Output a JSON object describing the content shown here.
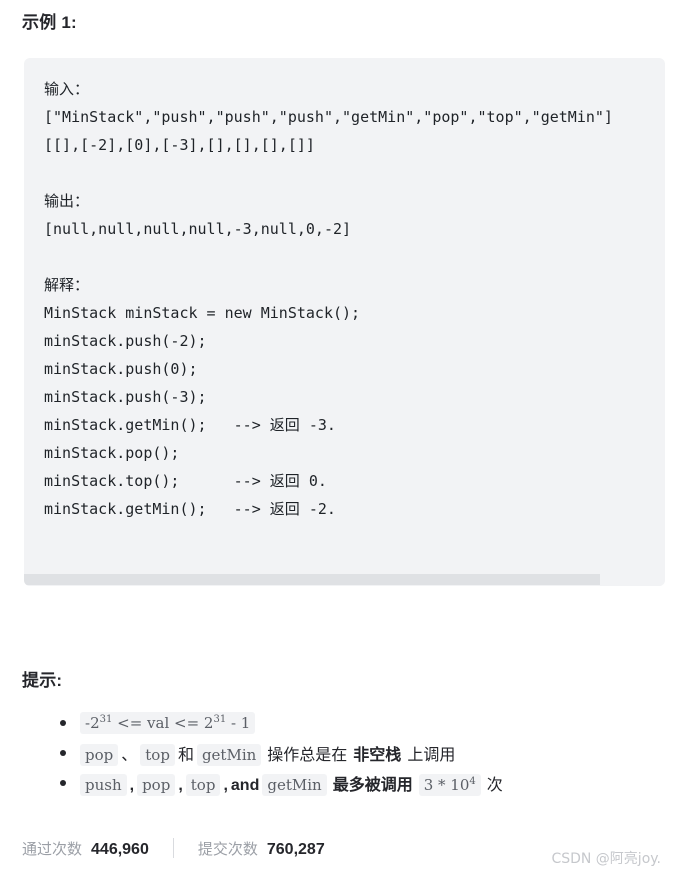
{
  "example": {
    "heading": "示例 1:",
    "code_lines": [
      "输入：",
      "[\"MinStack\",\"push\",\"push\",\"push\",\"getMin\",\"pop\",\"top\",\"getMin\"]",
      "[[],[-2],[0],[-3],[],[],[],[]]",
      "",
      "输出：",
      "[null,null,null,null,-3,null,0,-2]",
      "",
      "解释：",
      "MinStack minStack = new MinStack();",
      "minStack.push(-2);",
      "minStack.push(0);",
      "minStack.push(-3);",
      "minStack.getMin();   --> 返回 -3.",
      "minStack.pop();",
      "minStack.top();      --> 返回 0.",
      "minStack.getMin();   --> 返回 -2."
    ]
  },
  "hints": {
    "heading": "提示:",
    "items": [
      {
        "parts": [
          {
            "kind": "code",
            "text": "-2",
            "sup": "31",
            "tail": " <= val <= 2",
            "sup2": "31",
            "tail2": " - 1"
          }
        ]
      },
      {
        "code1": "pop",
        "sep1": "、",
        "code2": "top",
        "sep2": "和",
        "code3": "getMin",
        "text_mid": "操作总是在",
        "bold": "非空栈",
        "text_end": "上调用"
      },
      {
        "code1": "push",
        "sep1": ",",
        "code2": "pop",
        "sep2": ",",
        "code3": "top",
        "sep3": ",",
        "and_word": "and",
        "code4": "getMin",
        "text_mid": "最多被调用",
        "code_num": "3 * 10",
        "code_num_sup": "4",
        "text_end": "次"
      }
    ]
  },
  "footer": {
    "accepted_label": "通过次数",
    "accepted_value": "446,960",
    "submissions_label": "提交次数",
    "submissions_value": "760,287"
  },
  "watermark": "CSDN @阿亮joy."
}
